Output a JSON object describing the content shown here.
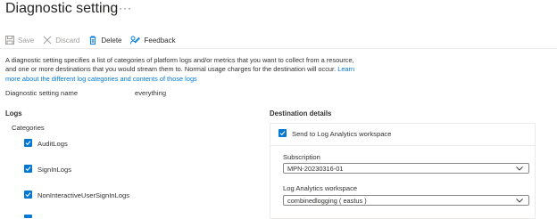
{
  "header": {
    "title": "Diagnostic setting",
    "more_label": "···"
  },
  "toolbar": {
    "save_label": "Save",
    "discard_label": "Discard",
    "delete_label": "Delete",
    "feedback_label": "Feedback"
  },
  "description": {
    "text": "A diagnostic setting specifies a list of categories of platform logs and/or metrics that you want to collect from a resource, and one or more destinations that you would stream them to. Normal usage charges for the destination will occur.",
    "link_text": "Learn more about the different log categories and contents of those logs"
  },
  "setting_name": {
    "label": "Diagnostic setting name",
    "value": "everything"
  },
  "logs": {
    "heading": "Logs",
    "categories_label": "Categories",
    "items": [
      {
        "label": "AuditLogs",
        "checked": true
      },
      {
        "label": "SignInLogs",
        "checked": true
      },
      {
        "label": "NonInteractiveUserSignInLogs",
        "checked": true
      }
    ]
  },
  "destination": {
    "heading": "Destination details",
    "send_la_label": "Send to Log Analytics workspace",
    "send_la_checked": true,
    "subscription_label": "Subscription",
    "subscription_value": "MPN-20230316-01",
    "workspace_label": "Log Analytics workspace",
    "workspace_value": "combinedlogging ( eastus )"
  },
  "colors": {
    "accent": "#0078d4",
    "disabled_text": "#a19f9d"
  }
}
